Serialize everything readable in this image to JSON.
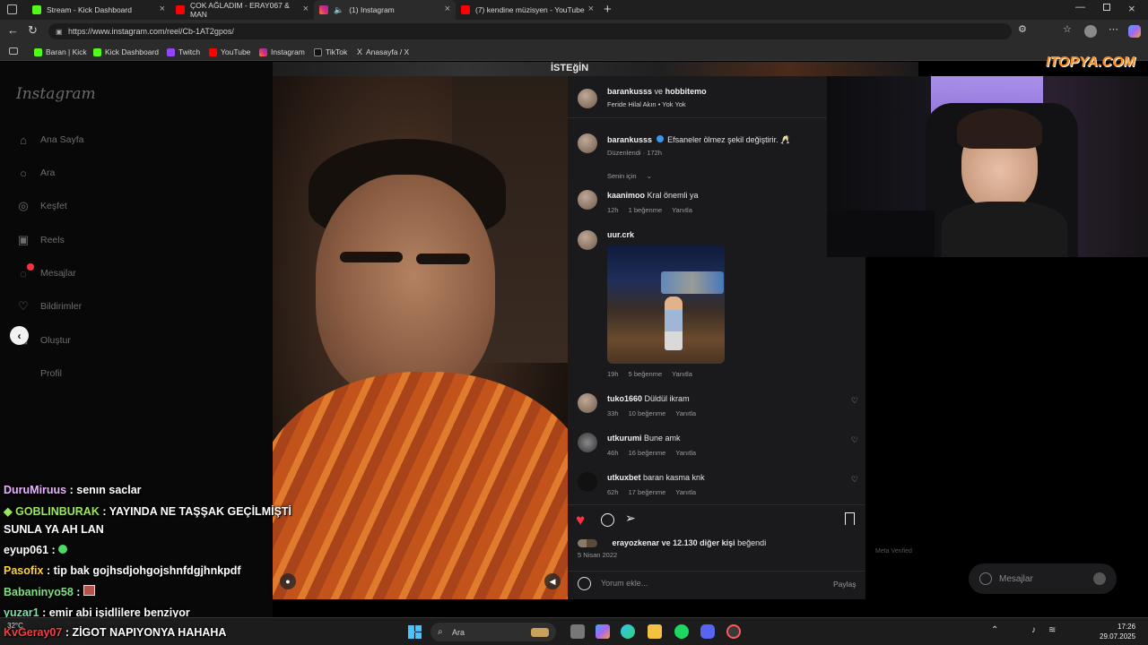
{
  "tabs": [
    {
      "label": "Stream - Kick Dashboard",
      "color": "#53fc18"
    },
    {
      "label": "ÇOK AĞLADIM - ERAY067 & MAN",
      "color": "#ff0000"
    },
    {
      "label": "(1) Instagram",
      "color": "#e1306c"
    },
    {
      "label": "(7) kendine müzisyen - YouTube",
      "color": "#ff0000"
    }
  ],
  "url": "https://www.instagram.com/reel/Cb-1AT2gpos/",
  "bookmarks": [
    "Baran | Kick",
    "Kick Dashboard",
    "Twitch",
    "YouTube",
    "Instagram",
    "TikTok",
    "Anasayfa / X"
  ],
  "sidebar": {
    "logo": "Instagram",
    "items": [
      "Ana Sayfa",
      "Ara",
      "Keşfet",
      "Reels",
      "Mesajlar",
      "Bildirimler",
      "Oluştur",
      "Profil"
    ]
  },
  "post": {
    "header_users": "barankusss",
    "header_and": "ve",
    "header_user2": "hobbitemo",
    "header_sub": "Feride Hilal Akın • Yok Yok",
    "caption_user": "barankusss",
    "caption_text": "Efsaneler ölmez şekil değiştirir. 🥂",
    "caption_meta": "Düzenlendi · 172h",
    "sort_label": "Senin için",
    "comments": [
      {
        "user": "kaanimoo",
        "text": "Kral önemli ya",
        "time": "12h",
        "likes": "1 beğenme",
        "reply": "Yanıtla"
      },
      {
        "user": "uur.crk",
        "text": "",
        "time": "19h",
        "likes": "5 beğenme",
        "reply": "Yanıtla"
      },
      {
        "user": "tuko1660",
        "text": "Düldül ikram",
        "time": "33h",
        "likes": "10 beğenme",
        "reply": "Yanıtla"
      },
      {
        "user": "utkurumi",
        "text": "Bune amk",
        "time": "46h",
        "likes": "16 beğenme",
        "reply": "Yanıtla"
      },
      {
        "user": "utkuxbet",
        "text": "baran kasma knk",
        "time": "62h",
        "likes": "17 beğenme",
        "reply": "Yanıtla"
      }
    ],
    "liked_by_user": "erayozkenar",
    "liked_by_rest": "ve 12.130 diğer kişi",
    "liked_by_tail": "beğendi",
    "date": "5 Nisan 2022",
    "comment_placeholder": "Yorum ekle...",
    "share_label": "Paylaş"
  },
  "messages_button": "Mesajlar",
  "meta_verified": "Meta Verified",
  "overlay_logo": "ITOPYA.COM",
  "overlay_top_text": "İSTEğİN",
  "chat": [
    {
      "user": "DuruMiruus",
      "msg": ": senın saclar",
      "color": "#e9b3ff"
    },
    {
      "user": "GOBLINBURAK",
      "msg": ": YAYINDA NE TAŞŞAK GEÇİLMİŞTİ",
      "color": "#9ce85b"
    },
    {
      "user": "",
      "msg": "SUNLA YA AH LAN",
      "color": "#ffffff"
    },
    {
      "user": "eyup061",
      "msg": ":",
      "color": "#ffffff"
    },
    {
      "user": "Pasofix",
      "msg": ": tip bak gojhsdjohgojshnfdgjhnkpdf",
      "color": "#ffd23c"
    },
    {
      "user": "Babaninyo58",
      "msg": ":",
      "color": "#7ee07e"
    },
    {
      "user": "yuzar1",
      "msg": ": emir abi işidlilere benziyor",
      "color": "#7fe0a8"
    },
    {
      "user": "KvGeray07",
      "msg": ": ZİGOT NAPIYONYA HAHAHA",
      "color": "#ff3b3b"
    }
  ],
  "taskbar": {
    "search": "Ara",
    "temp": "32°C",
    "time": "17:26",
    "date": "29.07.2025"
  }
}
